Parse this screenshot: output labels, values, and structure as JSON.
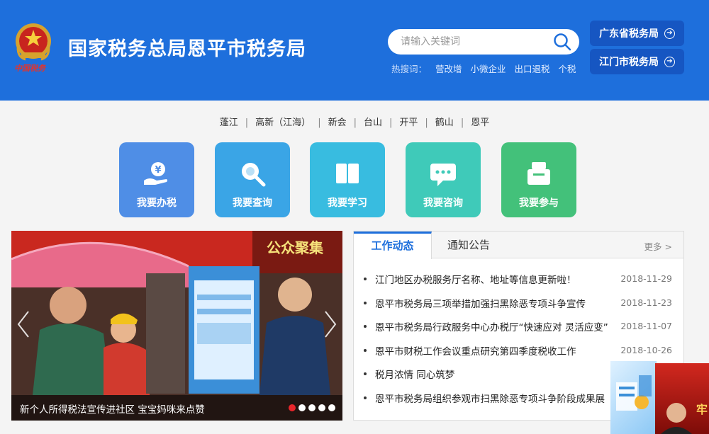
{
  "header": {
    "emblem_text": "中国税务",
    "title": "国家税务总局恩平市税务局",
    "search": {
      "placeholder": "请输入关键词"
    },
    "hot_label": "热搜词：",
    "hot_words": [
      "营改增",
      "小微企业",
      "出口退税",
      "个税"
    ],
    "links": [
      "广东省税务局",
      "江门市税务局"
    ]
  },
  "districts": [
    "蓬江",
    "高新（江海）",
    "新会",
    "台山",
    "开平",
    "鹤山",
    "恩平"
  ],
  "tiles": [
    {
      "label": "我要办税",
      "color": "#4f8ee6",
      "icon": "tax-payment-icon"
    },
    {
      "label": "我要查询",
      "color": "#3aa5e6",
      "icon": "search-query-icon"
    },
    {
      "label": "我要学习",
      "color": "#38bce0",
      "icon": "book-icon"
    },
    {
      "label": "我要咨询",
      "color": "#3fcab9",
      "icon": "chat-bubble-icon"
    },
    {
      "label": "我要参与",
      "color": "#43c17a",
      "icon": "ballot-box-icon"
    }
  ],
  "carousel": {
    "caption": "新个人所得税法宣传进社区 宝宝妈咪来点赞",
    "banner_text": "公众聚集",
    "dot_count": 5,
    "active_dot": 0
  },
  "news": {
    "tabs": [
      "工作动态",
      "通知公告"
    ],
    "more": "更多 >",
    "items": [
      {
        "title": "江门地区办税服务厅名称、地址等信息更新啦！",
        "date": "2018-11-29"
      },
      {
        "title": "恩平市税务局三项举措加强扫黑除恶专项斗争宣传",
        "date": "2018-11-23"
      },
      {
        "title": "恩平市税务局行政服务中心办税厅“快速应对 灵活应变”",
        "date": "2018-11-07"
      },
      {
        "title": "恩平市财税工作会议重点研究第四季度税收工作",
        "date": "2018-10-26"
      },
      {
        "title": "税月浓情 同心筑梦",
        "date": ""
      },
      {
        "title": "恩平市税务局组织参观市扫黑除恶专项斗争阶段成果展",
        "date": ""
      }
    ]
  },
  "float_banner_text": "牢"
}
